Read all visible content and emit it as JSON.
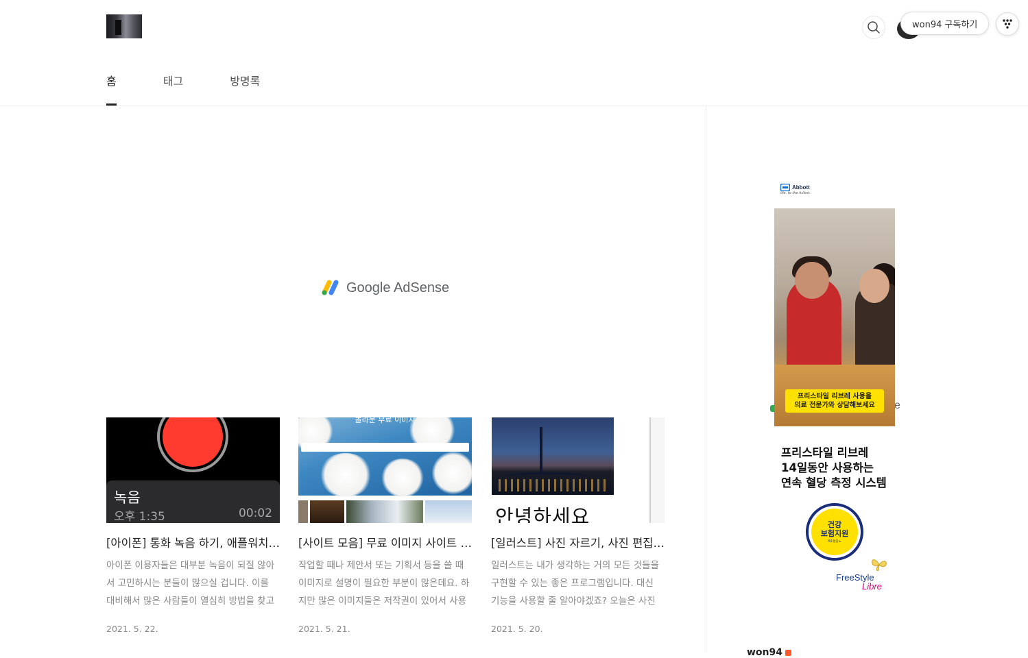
{
  "header": {
    "subscribe_label": "won94 구독하기"
  },
  "nav": {
    "items": [
      {
        "label": "홈",
        "active": true
      },
      {
        "label": "태그",
        "active": false
      },
      {
        "label": "방명록",
        "active": false
      }
    ]
  },
  "ad_placeholder": {
    "text": "Google AdSense"
  },
  "posts": [
    {
      "title": "[아이폰] 통화 녹음 하기, 애플워치로 통화 녹음하는 방법",
      "summary": "아이폰 이용자들은 대부분 녹음이 되질 않아서 고민하시는 분들이 많으실 겁니다. 이를 대비해서 많은 사람들이 열심히 방법을 찾고 있는데요.",
      "date": "2021. 5. 22.",
      "thumb": {
        "label": "녹음",
        "time": "오후 1:35",
        "duration": "00:02"
      }
    },
    {
      "title": "[사이트 모음] 무료 이미지 사이트 추천",
      "summary": "작업할 때나 제안서 또는 기획서 등을 쓸 때 이미지로 설명이 필요한 부분이 많은데요. 하지만 많은 이미지들은 저작권이 있어서 사용이 어렵습니다.",
      "date": "2021. 5. 21.",
      "thumb": {
        "heading": "놀라운 무료 이미지"
      }
    },
    {
      "title": "[일러스트] 사진 자르기, 사진 편집하는 방법",
      "summary": "일러스트는 내가 생각하는 거의 모든 것들을 구현할 수 있는 좋은 프로그램입니다. 대신 기능을 사용할 줄 알아야겠죠? 오늘은 사진 자르기를 알아보겠습니다.",
      "date": "2021. 5. 20.",
      "thumb": {
        "text": "안녕하세요"
      }
    }
  ],
  "sidebar_ad": {
    "brand": "Abbott",
    "tagline": "life. to the fullest.",
    "banner_line1": "프리스타일 리브레 사용을",
    "banner_line2": "의료 전문가와 상담해보세요",
    "headline_line1": "프리스타일 리브레",
    "headline_line2": "14일동안 사용하는",
    "headline_line3": "연속 혈당 측정 시스템",
    "seal_line1": "건강",
    "seal_line2": "보험지원",
    "seal_line3": "제1형당뇨",
    "product_line1": "FreeStyle",
    "product_line2": "Libre",
    "colors": {
      "banner": "#ffe100",
      "brand_blue": "#1a2d7a",
      "libre_pink": "#e2007a"
    }
  },
  "sidebar": {
    "blog_name": "won94"
  },
  "icons": [
    "search-icon",
    "dots-menu-icon",
    "adsense-logo-icon",
    "abbott-logo-icon",
    "butterfly-icon"
  ]
}
